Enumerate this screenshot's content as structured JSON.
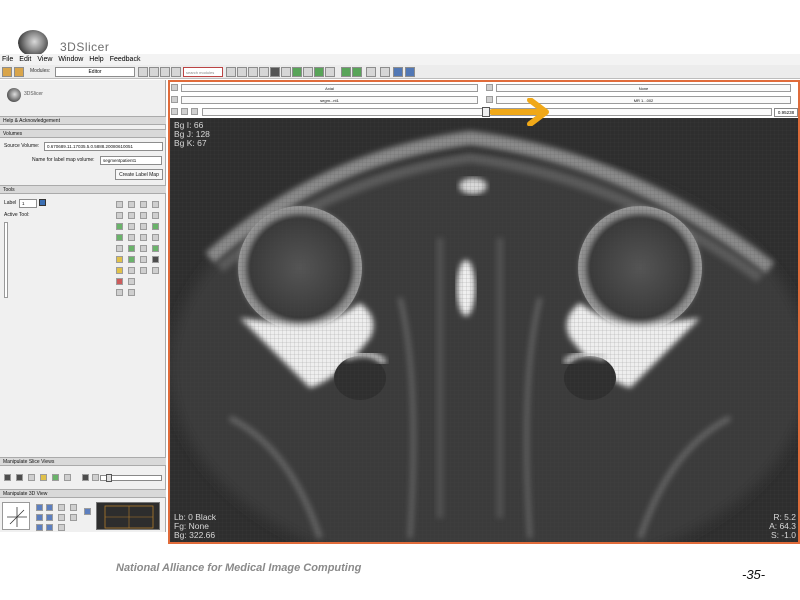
{
  "app": {
    "logo_text": "3DSlicer",
    "panel_logo_text": "3DSlicer"
  },
  "menu": {
    "items": [
      "File",
      "Edit",
      "View",
      "Window",
      "Help",
      "Feedback"
    ]
  },
  "toolbar": {
    "modules_label": "Modules:",
    "module_selected": "Editor",
    "search_placeholder": "search modules"
  },
  "sections": {
    "help": "Help & Acknowledgement",
    "volumes": "Volumes",
    "tools": "Tools",
    "slice_views": "Manipulate Slice Views",
    "view3d": "Manipulate 3D View"
  },
  "volumes": {
    "source_label": "Source Volume:",
    "source_value": "0.670689.11.17035.5.0.5888.20080610051",
    "labelmap_label": "Name for label map volume:",
    "labelmap_value": "segmentpatient1",
    "create_button": "Create Label Map"
  },
  "tools": {
    "label_text": "Label",
    "label_value": "1",
    "active_tool": "Active Tool:",
    "label_color": "#3b6fb3"
  },
  "viewer": {
    "orientation_left": "Axial",
    "orientation_right": "None",
    "volume_left": "segm...nt1",
    "volume_right": "MR 1...002",
    "zoom_value": "0.95238",
    "frame_color": "#e06b3a",
    "arrow_color": "#f0a818"
  },
  "overlay": {
    "bg_i": "Bg I: 66",
    "bg_j": "Bg J: 128",
    "bg_k": "Bg K: 67",
    "lb": "Lb: 0 Black",
    "fg": "Fg: None",
    "bg": "Bg: 322.66",
    "r": "R: 5.2",
    "a": "A: 64.3",
    "s": "S: -1.0"
  },
  "footer": {
    "organization": "National Alliance for Medical Image Computing",
    "page": "-35-"
  }
}
